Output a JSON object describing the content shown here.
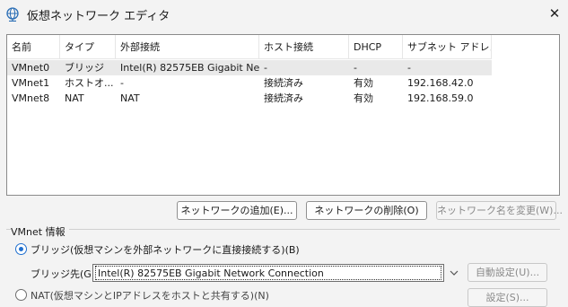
{
  "window": {
    "title": "仮想ネットワーク エディタ",
    "icon": "globe-network-icon",
    "close_glyph": "✕"
  },
  "network_list": {
    "columns": [
      "名前",
      "タイプ",
      "外部接続",
      "ホスト接続",
      "DHCP",
      "サブネット アドレス"
    ],
    "rows": [
      [
        "VMnet0",
        "ブリッジ",
        "Intel(R) 82575EB Gigabit Ne...",
        "-",
        "-",
        "-"
      ],
      [
        "VMnet1",
        "ホストオ...",
        "-",
        "接続済み",
        "有効",
        "192.168.42.0"
      ],
      [
        "VMnet8",
        "NAT",
        "NAT",
        "接続済み",
        "有効",
        "192.168.59.0"
      ]
    ],
    "selected_row": 0
  },
  "buttons": {
    "add_network": "ネットワークの追加(E)...",
    "remove_network": "ネットワークの削除(O)",
    "rename_network": "ネットワーク名を変更(W)..."
  },
  "vmnet_info": {
    "group_label": "VMnet 情報",
    "bridge_option": "ブリッジ(仮想マシンを外部ネットワークに直接接続する)(B)",
    "bridge_to_label": "ブリッジ先(G):",
    "bridge_to_value": "Intel(R) 82575EB Gigabit Network Connection",
    "auto_settings": "自動設定(U)...",
    "next_option_partial": "NAT(仮想マシンとIPアドレスをホストと共有する)(N)",
    "next_button_partial": "設定(S)..."
  },
  "colors": {
    "accent": "#1f6fcf",
    "selection": "#e9e9e9",
    "window_bg": "#f3f3f3"
  }
}
